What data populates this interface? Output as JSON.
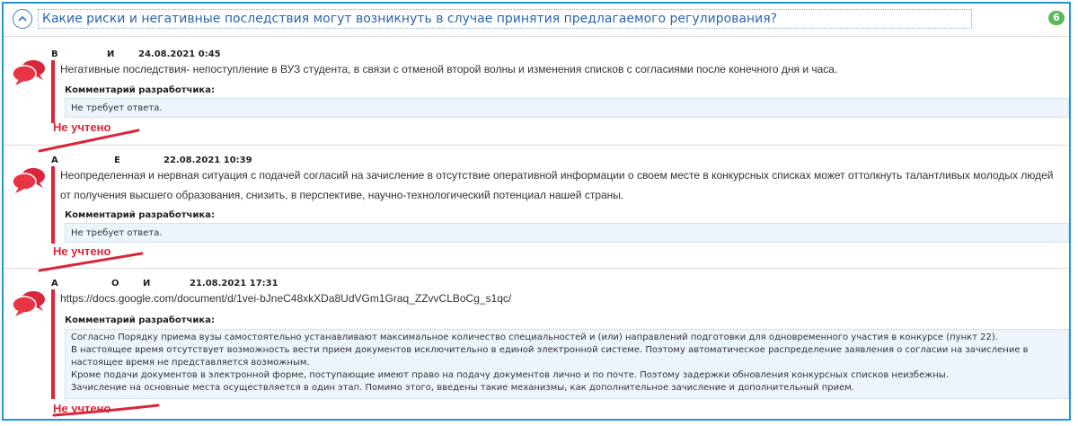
{
  "header": {
    "question": "Какие риски и негативные последствия могут возникнуть в случае принятия предлагаемого регулирования?",
    "count": "6"
  },
  "entries": [
    {
      "author": [
        "В",
        "И"
      ],
      "date": "24.08.2021 0:45",
      "text": "Негативные последствия- непоступление в ВУЗ студента, в связи с отменой второй волны и изменения списков с согласиями после конечного дня и часа.",
      "comment_label": "Комментарий разработчика:",
      "comment": "Не требует ответа.",
      "stamp": "Не учтено"
    },
    {
      "author": [
        "А",
        "Е"
      ],
      "date": "22.08.2021 10:39",
      "text_lines": [
        "Неопределенная и нервная ситуация с подачей согласий на зачисление в отсутствие оперативной информации о своем месте в конкурсных списках может оттолкнуть талантливых молодых людей",
        "от получения высшего образования, снизить, в перспективе, научно-технологический потенциал нашей страны."
      ],
      "comment_label": "Комментарий разработчика:",
      "comment": "Не требует ответа.",
      "stamp": "Не учтено"
    },
    {
      "author": [
        "А",
        "О",
        "И"
      ],
      "date": "21.08.2021 17:31",
      "text": "https://docs.google.com/document/d/1vei-bJneC48xkXDa8UdVGm1Graq_ZZvvCLBoCg_s1qc/",
      "comment_label": "Комментарий разработчика:",
      "comment_lines": [
        "Согласно Порядку приема вузы самостоятельно устанавливают максимальное количество специальностей и (или) направлений подготовки для одновременного участия в конкурсе (пункт 22).",
        "В настоящее время отсутствует возможность вести прием документов исключительно в единой электронной системе. Поэтому автоматическое распределение заявления о согласии на зачисление в",
        "настоящее время не представляется возможным.",
        "Кроме подачи документов в электронной форме, поступающие имеют право на подачу документов лично и по почте. Поэтому задержки обновления конкурсных списков неизбежны.",
        "Зачисление на основные места осуществляется в один этап. Помимо этого, введены такие механизмы, как дополнительное зачисление и дополнительный прием."
      ],
      "stamp": "Не учтено"
    }
  ]
}
